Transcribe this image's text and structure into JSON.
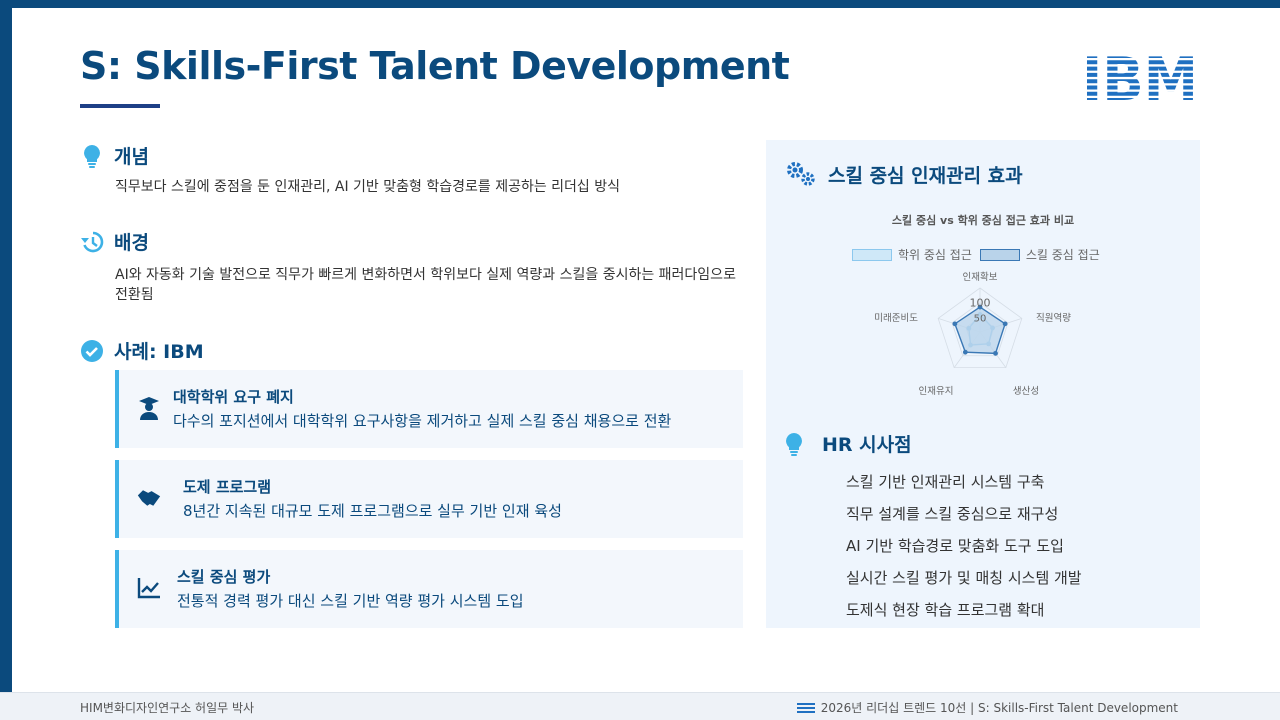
{
  "title": "S: Skills-First Talent Development",
  "logo": {
    "text": "IBM",
    "color": "#1f70c1"
  },
  "concept": {
    "heading": "개념",
    "icon": "lightbulb-icon",
    "body": "직무보다 스킬에 중점을 둔 인재관리, AI 기반 맞춤형 학습경로를 제공하는 리더십 방식"
  },
  "background": {
    "heading": "배경",
    "icon": "history-icon",
    "body": "AI와 자동화 기술 발전으로 직무가 빠르게 변화하면서 학위보다 실제 역량과 스킬을 중시하는 패러다임으로 전환됨"
  },
  "case": {
    "heading": "사례: IBM",
    "icon": "check-circle-icon",
    "items": [
      {
        "icon": "graduation-cap-user-icon",
        "title": "대학학위 요구 폐지",
        "desc": "다수의 포지션에서 대학학위 요구사항을 제거하고 실제 스킬 중심 채용으로 전환"
      },
      {
        "icon": "handshake-icon",
        "title": "도제 프로그램",
        "desc": "8년간 지속된 대규모 도제 프로그램으로 실무 기반 인재 육성"
      },
      {
        "icon": "line-chart-icon",
        "title": "스킬 중심 평가",
        "desc": "전통적 경력 평가 대신 스킬 기반 역량 평가 시스템 도입"
      }
    ]
  },
  "effects": {
    "heading": "스킬 중심 인재관리 효과",
    "icon": "gears-icon"
  },
  "chart_data": {
    "type": "radar",
    "title": "스킬 중심 vs 학위 중심 접근 효과 비교",
    "categories": [
      "인재확보",
      "직원역량",
      "생산성",
      "인재유지",
      "미래준비도"
    ],
    "tick_labels": [
      "50",
      "100"
    ],
    "range": [
      0,
      150
    ],
    "series": [
      {
        "name": "학위 중심 접근",
        "values": [
          60,
          45,
          50,
          55,
          40
        ],
        "fill": "#cfe8f8",
        "stroke": "#8cc8ee"
      },
      {
        "name": "스킬 중심 접근",
        "values": [
          85,
          90,
          90,
          85,
          90
        ],
        "fill": "#b9d3ea",
        "stroke": "#3a78b5"
      }
    ],
    "legend": "top"
  },
  "hr": {
    "heading": "HR 시사점",
    "icon": "lightbulb-icon",
    "items": [
      "스킬 기반 인재관리 시스템 구축",
      "직무 설계를 스킬 중심으로 재구성",
      "AI 기반 학습경로 맞춤화 도구 도입",
      "실시간 스킬 평가 및 매칭 시스템 개발",
      "도제식 현장 학습 프로그램 확대"
    ]
  },
  "footer": {
    "left": "HIM변화디자인연구소 허일무 박사",
    "right": "2026년 리더십 트렌드 10선 | S: Skills-First Talent Development",
    "icon": "ibm-mini-icon"
  }
}
